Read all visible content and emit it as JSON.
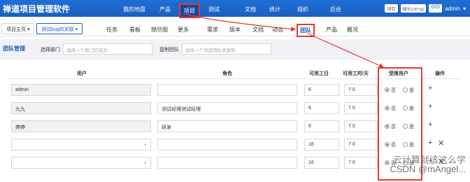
{
  "app": {
    "title": "禅道项目管理软件"
  },
  "topnav": {
    "items": [
      {
        "label": "我的地盘"
      },
      {
        "label": "产品"
      },
      {
        "label": "项目"
      },
      {
        "label": "测试"
      },
      {
        "label": "文档"
      },
      {
        "label": "统计"
      },
      {
        "label": "组织"
      },
      {
        "label": "后台"
      }
    ],
    "search_scope": "项目",
    "search_placeholder": "编号(ctrl+g)",
    "go_label": "GO!",
    "user": "admin"
  },
  "subnav": {
    "home": "项目主页",
    "project": "测试bug的关联",
    "items": [
      {
        "label": "任务"
      },
      {
        "label": "看板"
      },
      {
        "label": "燃尽图"
      },
      {
        "label": "更多"
      },
      {
        "label": "需求"
      },
      {
        "label": "版本"
      },
      {
        "label": "文档"
      },
      {
        "label": "动态"
      },
      {
        "label": "团队"
      },
      {
        "label": "产品"
      },
      {
        "label": "概况"
      }
    ]
  },
  "filter": {
    "tab": "团队管理",
    "dept_label": "选择部门",
    "dept_placeholder": "选择一个部门的成员",
    "copy_label": "复制团队",
    "copy_placeholder": "选择一个项目团队来复制"
  },
  "table": {
    "headers": {
      "user": "用户",
      "role": "角色",
      "days": "可用工日",
      "hours": "可用工时/天",
      "limited": "受限用户",
      "actions": "操作"
    },
    "yes": "是",
    "no": "否",
    "rows": [
      {
        "user": "admin",
        "role": "",
        "days": "6",
        "hours": "7.0"
      },
      {
        "user": "九九",
        "role": "测试经理测试经理",
        "days": "6",
        "hours": "7.0"
      },
      {
        "user": "婷婷",
        "role": "研发",
        "days": "6",
        "hours": "7.0"
      },
      {
        "user": "",
        "role": "",
        "days": "16",
        "hours": "7.0"
      },
      {
        "user": "",
        "role": "",
        "days": "16",
        "hours": "7.0"
      }
    ]
  },
  "watermark": {
    "line1": "云计算就该这么学",
    "line2": "CSDN @mAngel..."
  }
}
